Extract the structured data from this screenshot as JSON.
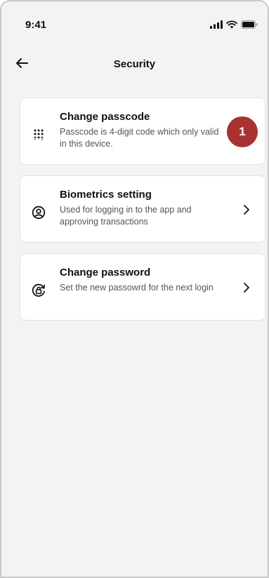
{
  "status_bar": {
    "time": "9:41",
    "icons": [
      "signal-icon",
      "wifi-icon",
      "battery-icon"
    ]
  },
  "header": {
    "back_icon": "arrow-left-icon",
    "title": "Security"
  },
  "items": [
    {
      "icon": "keypad-icon",
      "title": "Change passcode",
      "description": "Passcode is 4-digit code which only valid in this device.",
      "badge": "1"
    },
    {
      "icon": "face-user-icon",
      "title": "Biometrics setting",
      "description": "Used for logging in to the app and approving transactions",
      "chevron": "chevron-right-icon"
    },
    {
      "icon": "lock-rotate-icon",
      "title": "Change password",
      "description": "Set the new passowrd for the next login",
      "chevron": "chevron-right-icon"
    }
  ],
  "colors": {
    "background": "#f3f3f4",
    "card": "#ffffff",
    "badge": "#a83232",
    "text_primary": "#111111",
    "text_secondary": "#555555"
  }
}
